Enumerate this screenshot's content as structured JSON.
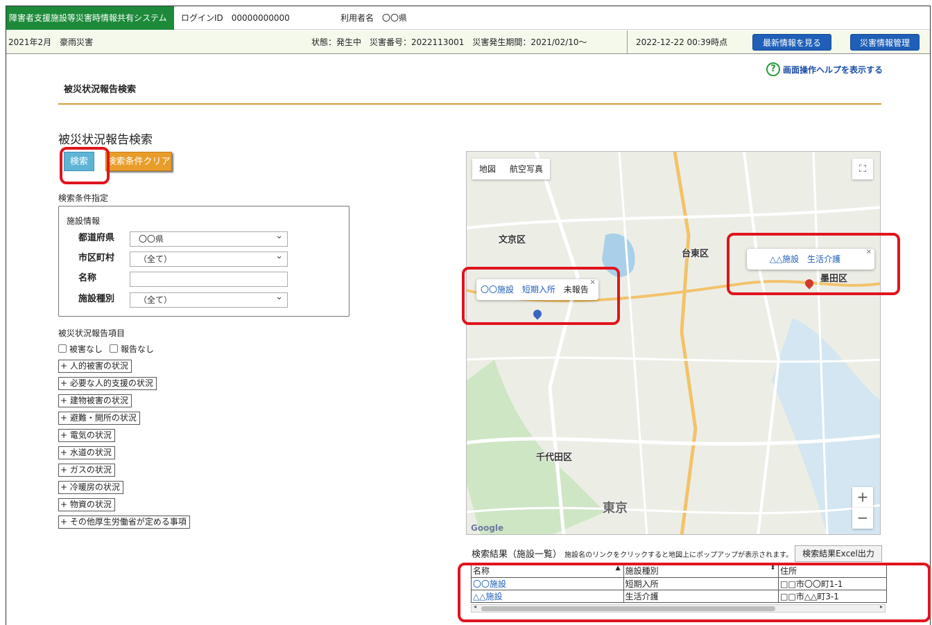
{
  "header": {
    "app_title": "障害者支援施設等災害時情報共有システム",
    "login_id": "ログインID　00000000000",
    "user_name": "利用者名　〇〇県"
  },
  "disaster_bar": {
    "name": "2021年2月　豪雨災害",
    "status": "状態：発生中　災害番号：2022113001　災害発生期間：2021/02/10～",
    "timestamp": "2022-12-22 00:39時点",
    "latest_button": "最新情報を見る",
    "manage_button": "災害情報管理"
  },
  "help": {
    "icon": "question-circle-icon",
    "text": "画面操作ヘルプを表示する"
  },
  "page_title": "被災状況報告検索",
  "section_title": "被災状況報告検索",
  "buttons": {
    "search": "検索",
    "clear": "検索条件クリア"
  },
  "conditions": {
    "label": "検索条件指定",
    "group_label": "施設情報",
    "prefecture": {
      "label": "都道府県",
      "value": "〇〇県"
    },
    "city": {
      "label": "市区町村",
      "value": "（全て）"
    },
    "name": {
      "label": "名称",
      "value": ""
    },
    "facility_type": {
      "label": "施設種別",
      "value": "（全て）"
    }
  },
  "report_items": {
    "label": "被災状況報告項目",
    "checkboxes": [
      "被害なし",
      "報告なし"
    ],
    "expanders": [
      "+ 人的被害の状況",
      "+ 必要な人的支援の状況",
      "+ 建物被害の状況",
      "+ 避難・開所の状況",
      "+ 電気の状況",
      "+ 水道の状況",
      "+ ガスの状況",
      "+ 冷暖房の状況",
      "+ 物資の状況",
      "+ その他厚生労働省が定める事項"
    ]
  },
  "map": {
    "tabs": [
      "地図",
      "航空写真"
    ],
    "labels": [
      "文京区",
      "台東区",
      "墨田区",
      "千代田区",
      "東京"
    ],
    "popup1": {
      "name": "〇〇施設",
      "type": "短期入所",
      "status": "未報告"
    },
    "popup2": {
      "name": "△△施設",
      "type": "生活介護"
    },
    "close": "×",
    "zoom_in": "+",
    "zoom_out": "−",
    "google": "Google",
    "fullscreen": "⛶"
  },
  "results": {
    "title": "検索結果（施設一覧）",
    "hint": "施設名のリンクをクリックすると地図上にポップアップが表示されます。",
    "excel_button": "検索結果Excel出力",
    "columns": [
      "名称",
      "施設種別",
      "住所"
    ],
    "rows": [
      {
        "name": "〇〇施設",
        "type": "短期入所",
        "address": "□□市〇〇町1-1"
      },
      {
        "name": "△△施設",
        "type": "生活介護",
        "address": "□□市△△町3-1"
      }
    ]
  }
}
